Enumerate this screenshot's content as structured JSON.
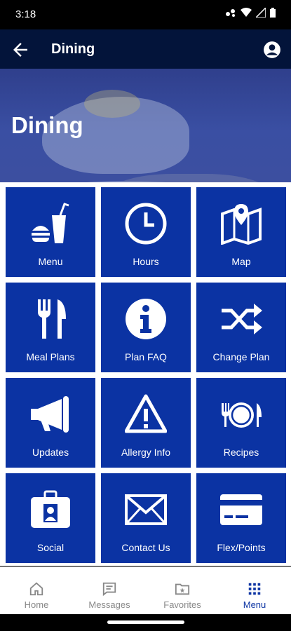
{
  "status_bar": {
    "time": "3:18"
  },
  "app_bar": {
    "title": "Dining"
  },
  "hero": {
    "title": "Dining"
  },
  "tiles": [
    {
      "label": "Menu",
      "icon": "fast-food-icon"
    },
    {
      "label": "Hours",
      "icon": "clock-icon"
    },
    {
      "label": "Map",
      "icon": "map-icon"
    },
    {
      "label": "Meal Plans",
      "icon": "fork-knife-icon"
    },
    {
      "label": "Plan FAQ",
      "icon": "info-icon"
    },
    {
      "label": "Change Plan",
      "icon": "shuffle-icon"
    },
    {
      "label": "Updates",
      "icon": "megaphone-icon"
    },
    {
      "label": "Allergy Info",
      "icon": "warning-icon"
    },
    {
      "label": "Recipes",
      "icon": "plate-icon"
    },
    {
      "label": "Social",
      "icon": "id-badge-icon"
    },
    {
      "label": "Contact Us",
      "icon": "envelope-icon"
    },
    {
      "label": "Flex/Points",
      "icon": "credit-card-icon"
    }
  ],
  "bottom_nav": [
    {
      "label": "Home",
      "icon": "home-icon"
    },
    {
      "label": "Messages",
      "icon": "messages-icon"
    },
    {
      "label": "Favorites",
      "icon": "favorites-icon"
    },
    {
      "label": "Menu",
      "icon": "grid-menu-icon",
      "active": true
    }
  ],
  "colors": {
    "tile": "#0b33a3",
    "app_bar": "#03143a",
    "active_nav": "#0b33a3",
    "inactive_nav": "#888888"
  }
}
